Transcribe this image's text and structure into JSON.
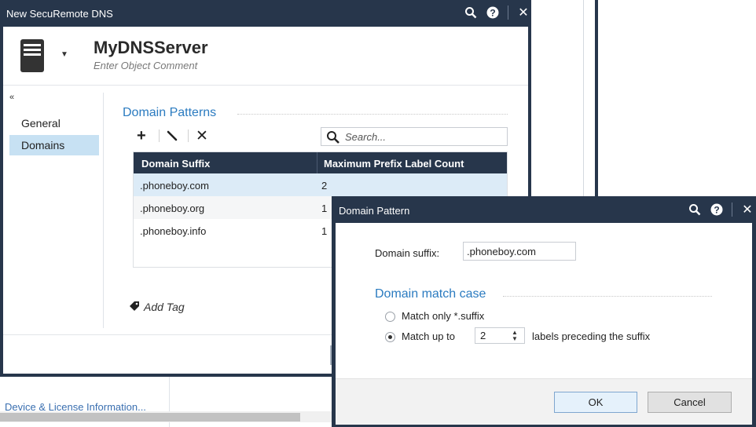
{
  "background": {
    "link_text": "Device & License Information..."
  },
  "main_window": {
    "title": "New SecuRemote DNS",
    "object_name": "MyDNSServer",
    "comment_placeholder": "Enter Object Comment",
    "collapse_glyph": "«",
    "nav": {
      "general": "General",
      "domains": "Domains"
    },
    "section_title": "Domain Patterns",
    "toolbar": {
      "add_glyph": "+",
      "delete_glyph": "✕"
    },
    "search_placeholder": "Search...",
    "table": {
      "columns": [
        "Domain Suffix",
        "Maximum Prefix Label Count"
      ],
      "rows": [
        {
          "suffix": ".phoneboy.com",
          "count": "2",
          "selected": true
        },
        {
          "suffix": ".phoneboy.org",
          "count": "1",
          "selected": false
        },
        {
          "suffix": ".phoneboy.info",
          "count": "1",
          "selected": false
        }
      ]
    },
    "add_tag": "Add Tag"
  },
  "dialog": {
    "title": "Domain Pattern",
    "suffix_label": "Domain suffix:",
    "suffix_value": ".phoneboy.com",
    "section_title": "Domain match case",
    "radio_only": "Match only *.suffix",
    "radio_upto": "Match up to",
    "upto_value": "2",
    "upto_suffix": "labels preceding the suffix",
    "selected_option": "upto",
    "ok_label": "OK",
    "cancel_label": "Cancel"
  },
  "title_icons": {
    "search": "🔍",
    "help": "?",
    "close": "✕"
  },
  "colors": {
    "title_bar": "#27364b",
    "accent": "#2b7bc0",
    "selection": "#c7e1f3",
    "row_selected": "#dcebf7"
  }
}
